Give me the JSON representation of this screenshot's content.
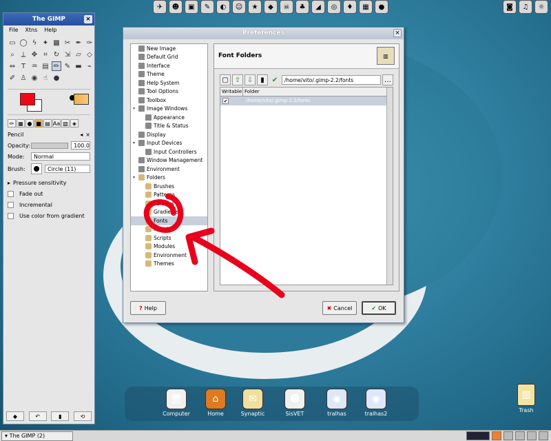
{
  "desktop": {
    "dock": [
      {
        "label": "Computer"
      },
      {
        "label": "Home"
      },
      {
        "label": "Synaptic"
      },
      {
        "label": "SisVET"
      },
      {
        "label": "tralhas"
      },
      {
        "label": "tralhas2"
      }
    ],
    "trash_label": "Trash"
  },
  "gimp": {
    "title": "The GIMP",
    "menu": [
      "File",
      "Xtns",
      "Help"
    ],
    "tool_options": {
      "tool_name": "Pencil",
      "opacity_label": "Opacity:",
      "opacity_value": "100.0",
      "mode_label": "Mode:",
      "mode_value": "Normal",
      "brush_label": "Brush:",
      "brush_value": "Circle (11)",
      "pressure_label": "Pressure sensitivity",
      "fade_label": "Fade out",
      "incremental_label": "Incremental",
      "gradient_label": "Use color from gradient"
    }
  },
  "prefs": {
    "title": "Preferences",
    "tree": [
      {
        "label": "New Image",
        "level": 1
      },
      {
        "label": "Default Grid",
        "level": 1
      },
      {
        "label": "Interface",
        "level": 1
      },
      {
        "label": "Theme",
        "level": 1
      },
      {
        "label": "Help System",
        "level": 1
      },
      {
        "label": "Tool Options",
        "level": 1
      },
      {
        "label": "Toolbox",
        "level": 1
      },
      {
        "label": "Image Windows",
        "level": 0
      },
      {
        "label": "Appearance",
        "level": 2
      },
      {
        "label": "Title & Status",
        "level": 2
      },
      {
        "label": "Display",
        "level": 1
      },
      {
        "label": "Input Devices",
        "level": 0
      },
      {
        "label": "Input Controllers",
        "level": 2
      },
      {
        "label": "Window Management",
        "level": 1
      },
      {
        "label": "Environment",
        "level": 1
      },
      {
        "label": "Folders",
        "level": 0
      },
      {
        "label": "Brushes",
        "level": 2
      },
      {
        "label": "Patterns",
        "level": 2
      },
      {
        "label": "Palettes",
        "level": 2
      },
      {
        "label": "Gradients",
        "level": 2
      },
      {
        "label": "Fonts",
        "level": 2,
        "selected": true
      },
      {
        "label": "Plug-Ins",
        "level": 2
      },
      {
        "label": "Scripts",
        "level": 2
      },
      {
        "label": "Modules",
        "level": 2
      },
      {
        "label": "Environment",
        "level": 2
      },
      {
        "label": "Themes",
        "level": 2
      }
    ],
    "header_title": "Font Folders",
    "path_value": "/home/vito/.gimp-2.2/fonts",
    "columns": {
      "writable": "Writable",
      "folder": "Folder"
    },
    "rows": [
      {
        "folder": "/home/vito/.gimp-2.2/fonts",
        "writable": true
      }
    ],
    "help_label": "Help",
    "cancel_label": "Cancel",
    "ok_label": "OK"
  },
  "taskbar": {
    "task": "The GIMP (2)"
  },
  "colors": {
    "foreground": "#f00614",
    "annotation": "#e8001c",
    "selection": "#c7cfdc"
  }
}
